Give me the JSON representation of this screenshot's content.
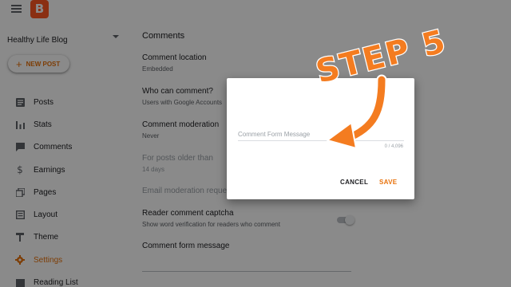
{
  "topbar": {
    "logo_text": "B"
  },
  "sidebar": {
    "blog_name": "Healthy Life Blog",
    "new_post_label": "NEW POST",
    "items": [
      {
        "label": "Posts",
        "icon": "posts-icon"
      },
      {
        "label": "Stats",
        "icon": "stats-icon"
      },
      {
        "label": "Comments",
        "icon": "comments-icon"
      },
      {
        "label": "Earnings",
        "icon": "dollar-icon"
      },
      {
        "label": "Pages",
        "icon": "pages-icon"
      },
      {
        "label": "Layout",
        "icon": "layout-icon"
      },
      {
        "label": "Theme",
        "icon": "theme-paint-roller-icon"
      },
      {
        "label": "Settings",
        "icon": "gear-icon",
        "active": true
      },
      {
        "label": "Reading List",
        "icon": "reading-list-icon"
      }
    ]
  },
  "main": {
    "section_title": "Comments",
    "settings": [
      {
        "label": "Comment location",
        "value": "Embedded"
      },
      {
        "label": "Who can comment?",
        "value": "Users with Google Accounts"
      },
      {
        "label": "Comment moderation",
        "value": "Never"
      },
      {
        "label": "For posts older than",
        "value": "14 days",
        "disabled": true
      },
      {
        "label": "Email moderation requests",
        "value": "",
        "disabled": true
      },
      {
        "label": "Reader comment captcha",
        "value": "Show word verification for readers who comment"
      },
      {
        "label": "Comment form message",
        "value": ""
      }
    ]
  },
  "dialog": {
    "input_placeholder": "Comment Form Message",
    "counter": "0 / 4,096",
    "cancel_label": "CANCEL",
    "save_label": "SAVE"
  },
  "annotation": {
    "text": "STEP 5",
    "color": "#f47c20"
  },
  "colors": {
    "accent": "#e8710a",
    "brand": "#ff5722",
    "scrim": "rgba(0,0,0,0.46)"
  }
}
